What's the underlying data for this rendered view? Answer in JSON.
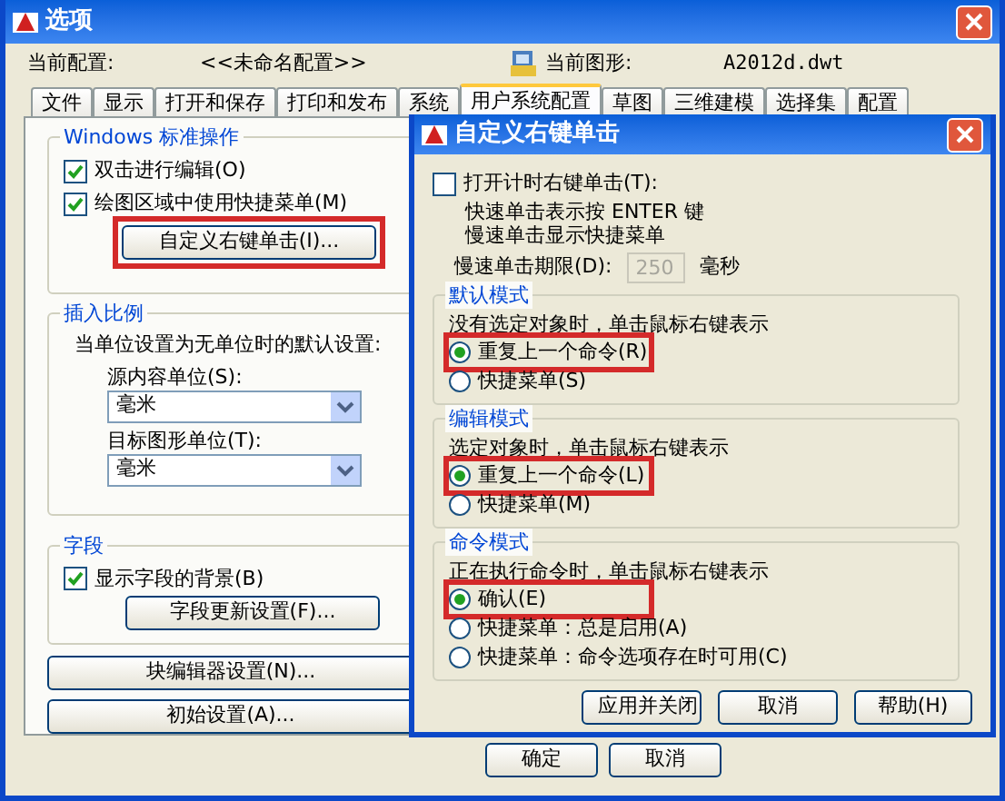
{
  "window": {
    "title": "选项"
  },
  "header": {
    "profile_label": "当前配置:",
    "profile": "<<未命名配置>>",
    "drawing_label": "当前图形:",
    "drawing": "A2012d.dwt"
  },
  "tabs": [
    {
      "label": "文件",
      "selected": false
    },
    {
      "label": "显示",
      "selected": false
    },
    {
      "label": "打开和保存",
      "selected": false
    },
    {
      "label": "打印和发布",
      "selected": false
    },
    {
      "label": "系统",
      "selected": false
    },
    {
      "label": "用户系统配置",
      "selected": true
    },
    {
      "label": "草图",
      "selected": false
    },
    {
      "label": "三维建模",
      "selected": false
    },
    {
      "label": "选择集",
      "selected": false
    },
    {
      "label": "配置",
      "selected": false
    }
  ],
  "windows_group": {
    "legend": "Windows 标准操作",
    "checkboxes": [
      {
        "label": "双击进行编辑(O)",
        "checked": true
      },
      {
        "label": "绘图区域中使用快捷菜单(M)",
        "checked": true
      }
    ],
    "button": {
      "label": "自定义右键单击(I)...",
      "highlighted": true
    }
  },
  "insert_scale": {
    "legend": "插入比例",
    "description": "当单位设置为无单位时的默认设置:",
    "fields": [
      {
        "label": "源内容单位(S):",
        "value": "毫米"
      },
      {
        "label": "目标图形单位(T):",
        "value": "毫米"
      }
    ]
  },
  "fields_group": {
    "legend": "字段",
    "checkbox": {
      "label": "显示字段的背景(B)",
      "checked": true
    },
    "button": {
      "label": "字段更新设置(F)...",
      "highlighted": false
    }
  },
  "buttons": [
    {
      "label": "块编辑器设置(N)..."
    },
    {
      "label": "初始设置(A)..."
    }
  ],
  "footer_buttons": [
    "确定",
    "取消"
  ],
  "dialog": {
    "title": "自定义右键单击",
    "timed": {
      "label": "打开计时右键单击(T):",
      "checked": false,
      "lines": [
        "快速单击表示按 ENTER 键",
        "慢速单击显示快捷菜单"
      ],
      "duration_label": "慢速单击期限(D):",
      "duration": "250",
      "disabled": true,
      "unit": "毫秒"
    },
    "groups": [
      {
        "legend": "默认模式",
        "description": "没有选定对象时，单击鼠标右键表示",
        "options": [
          {
            "label": "重复上一个命令(R)",
            "selected": true,
            "highlighted": true
          },
          {
            "label": "快捷菜单(S)",
            "selected": false,
            "highlighted": false
          }
        ]
      },
      {
        "legend": "编辑模式",
        "description": "选定对象时，单击鼠标右键表示",
        "options": [
          {
            "label": "重复上一个命令(L)",
            "selected": true,
            "highlighted": true
          },
          {
            "label": "快捷菜单(M)",
            "selected": false,
            "highlighted": false
          }
        ]
      },
      {
        "legend": "命令模式",
        "description": "正在执行命令时，单击鼠标右键表示",
        "options": [
          {
            "label": "确认(E)",
            "selected": true,
            "highlighted": true
          },
          {
            "label": "快捷菜单：总是启用(A)",
            "selected": false,
            "highlighted": false
          },
          {
            "label": "快捷菜单：命令选项存在时可用(C)",
            "selected": false,
            "highlighted": false
          }
        ]
      }
    ],
    "buttons": [
      "应用并关闭",
      "取消",
      "帮助(H)"
    ]
  }
}
